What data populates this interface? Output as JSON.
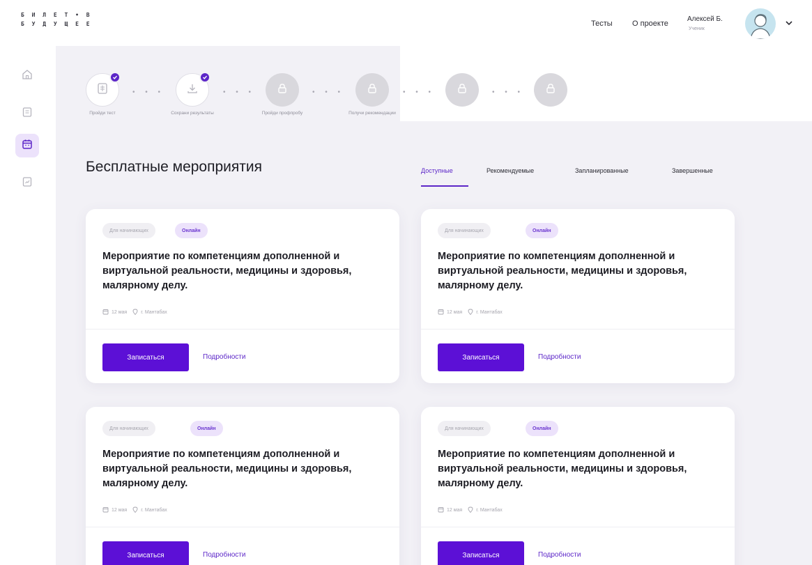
{
  "header": {
    "logo_line1": "Б И Л Е Т • В",
    "logo_line2": "Б У Д У Щ Е Е",
    "nav": [
      {
        "label": "Тесты"
      },
      {
        "label": "О проекте"
      }
    ],
    "user": {
      "name": "Алексей Б.",
      "role": "Ученик"
    }
  },
  "sidebar": {
    "items": [
      {
        "icon": "home-icon",
        "active": false
      },
      {
        "icon": "document-icon",
        "active": false
      },
      {
        "icon": "calendar-icon",
        "active": true
      },
      {
        "icon": "chart-icon",
        "active": false
      }
    ]
  },
  "progress": {
    "steps": [
      {
        "label": "Пройди тест",
        "status": "done",
        "icon": "test-icon"
      },
      {
        "label": "Сохрани результаты",
        "status": "done",
        "icon": "download-icon"
      },
      {
        "label": "Пройди профпробу",
        "status": "locked",
        "icon": "lock-icon"
      },
      {
        "label": "Получи рекомендации",
        "status": "locked",
        "icon": "lock-icon"
      },
      {
        "label": "",
        "status": "locked",
        "icon": "lock-icon"
      },
      {
        "label": "",
        "status": "locked",
        "icon": "lock-icon"
      }
    ]
  },
  "main": {
    "title": "Бесплатные мероприятия",
    "tabs": [
      {
        "label": "Доступные",
        "active": true
      },
      {
        "label": "Рекомендуемые",
        "active": false
      },
      {
        "label": "Запланированные",
        "active": false
      },
      {
        "label": "Завершенные",
        "active": false
      }
    ],
    "cards": [
      {
        "level": "Для начинающих",
        "format": "Онлайн",
        "title": "Мероприятие по компетенциям дополненной и виртуальной реальности, медицины и здоровья, малярному делу.",
        "date": "12 мая",
        "location": "г. Мантабах",
        "primary_label": "Записаться",
        "secondary_label": "Подробности"
      },
      {
        "level": "Для начинающих",
        "format": "Онлайн",
        "title": "Мероприятие по компетенциям дополненной и виртуальной реальности, медицины и здоровья, малярному делу.",
        "date": "12 мая",
        "location": "г. Мантабах",
        "primary_label": "Записаться",
        "secondary_label": "Подробности"
      },
      {
        "level": "Для начинающих",
        "format": "Онлайн",
        "title": "Мероприятие по компетенциям дополненной и виртуальной реальности, медицины и здоровья, малярному делу.",
        "date": "12 мая",
        "location": "г. Мантабах",
        "primary_label": "Записаться",
        "secondary_label": "Подробности"
      },
      {
        "level": "Для начинающих",
        "format": "Онлайн",
        "title": "Мероприятие по компетенциям дополненной и виртуальной реальности, медицины и здоровья, малярному делу.",
        "date": "12 мая",
        "location": "г. Мантабах",
        "primary_label": "Записаться",
        "secondary_label": "Подробности"
      }
    ]
  },
  "colors": {
    "accent": "#5c10d6",
    "accent_light": "#ece2fb",
    "background": "#f2f1f6"
  }
}
